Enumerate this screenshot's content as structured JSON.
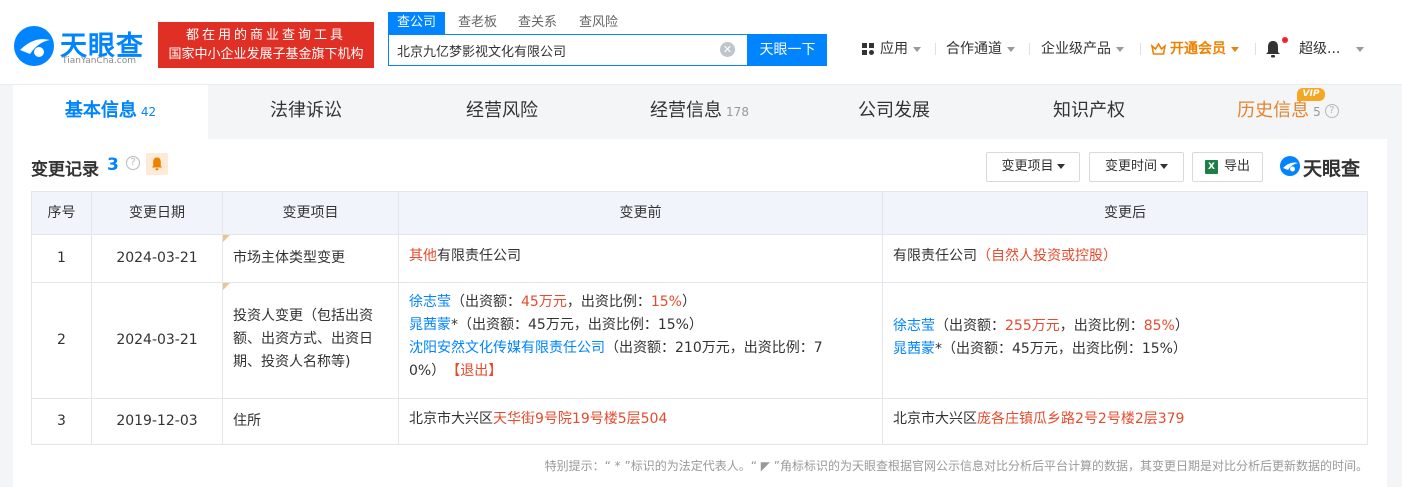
{
  "header": {
    "logo_cn": "天眼查",
    "logo_en": "TianYanCha.com",
    "slogan_line1": "都在用的商业查询工具",
    "slogan_line2": "国家中小企业发展子基金旗下机构",
    "search_tabs": [
      "查公司",
      "查老板",
      "查关系",
      "查风险"
    ],
    "search_value": "北京九亿梦影视文化有限公司",
    "search_button": "天眼一下",
    "nav": {
      "apps": "应用",
      "partner": "合作通道",
      "enterprise": "企业级产品",
      "vip": "开通会员",
      "user": "超级..."
    }
  },
  "tabs": [
    {
      "label": "基本信息",
      "count": "42"
    },
    {
      "label": "法律诉讼",
      "count": ""
    },
    {
      "label": "经营风险",
      "count": ""
    },
    {
      "label": "经营信息",
      "count": "178"
    },
    {
      "label": "公司发展",
      "count": ""
    },
    {
      "label": "知识产权",
      "count": ""
    },
    {
      "label": "历史信息",
      "count": "5"
    }
  ],
  "vip_badge": "VIP",
  "section": {
    "title": "变更记录",
    "count": "3",
    "filter_item": "变更项目",
    "filter_time": "变更时间",
    "export": "导出",
    "brand": "天眼查"
  },
  "table": {
    "headers": [
      "序号",
      "变更日期",
      "变更项目",
      "变更前",
      "变更后"
    ],
    "rows": [
      {
        "no": "1",
        "date": "2024-03-21",
        "item": "市场主体类型变更",
        "before": {
          "p1": "其他",
          "p2": "有限责任公司"
        },
        "after": {
          "p1": "有限责任公司",
          "p2": "（自然人投资或控股）"
        }
      },
      {
        "no": "2",
        "date": "2024-03-21",
        "item_l1": "投资人变更（包括出资",
        "item_l2": "额、出资方式、出资日",
        "item_l3": "期、投资人名称等)",
        "before": {
          "a_name": "徐志莹",
          "a_t1": "（出资额：",
          "a_amt": "45万元",
          "a_t2": "，出资比例：",
          "a_pct": "15%",
          "a_t3": "）",
          "b_name": "晁茜蒙",
          "b_rest": "*（出资额：45万元，出资比例：15%）",
          "c_name": "沈阳安然文化传媒有限责任公司",
          "c_rest1": "（出资额：210万元，出资比例：7",
          "c_rest2": "0%）",
          "c_exit": "【退出】"
        },
        "after": {
          "a_name": "徐志莹",
          "a_t1": "（出资额：",
          "a_amt": "255万元",
          "a_t2": "，出资比例：",
          "a_pct": "85%",
          "a_t3": "）",
          "b_name": "晁茜蒙",
          "b_rest": "*（出资额：45万元，出资比例：15%）"
        }
      },
      {
        "no": "3",
        "date": "2019-12-03",
        "item": "住所",
        "before": {
          "p1": "北京市大兴区",
          "p2": "天华街9号院19号楼5层504"
        },
        "after": {
          "p1": "北京市大兴区",
          "p2": "庞各庄镇瓜乡路2号2号楼2层379"
        }
      }
    ]
  },
  "footnote": "特别提示：“ * ”标识的为法定代表人。“ ◤ ”角标标识的为天眼查根据官网公示信息对比分析后平台计算的数据，其变更日期是对比分析后更新数据的时间。",
  "colors": {
    "accent": "#0084ff",
    "highlight": "#e54b2e",
    "vip": "#f08000",
    "slogan_bg": "#e02f25"
  }
}
